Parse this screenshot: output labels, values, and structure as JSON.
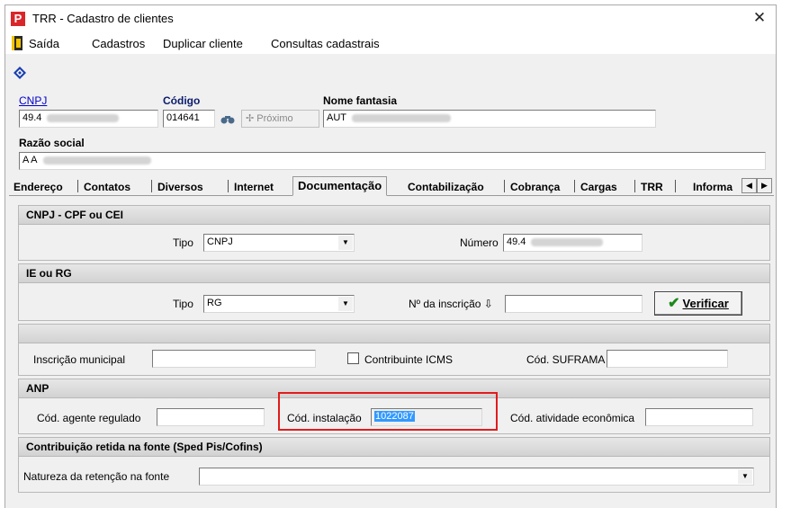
{
  "window": {
    "title": "TRR - Cadastro de clientes",
    "close_symbol": "✕",
    "app_icon": "P"
  },
  "menu": {
    "exit": "Saída",
    "registers": "Cadastros",
    "duplicate": "Duplicar cliente",
    "queries": "Consultas cadastrais"
  },
  "header": {
    "cnpj_label": "CNPJ",
    "cnpj_value": "49.4",
    "code_label": "Código",
    "code_value": "014641",
    "next_button": "✢ Próximo",
    "fantasy_label": "Nome fantasia",
    "fantasy_value": "AUT",
    "company_label": "Razão social",
    "company_value": "A A"
  },
  "tabs": [
    "Endereço",
    "Contatos",
    "Diversos",
    "Internet",
    "Documentação",
    "Contabilização",
    "Cobrança",
    "Cargas",
    "TRR",
    "Informa"
  ],
  "active_tab": "Documentação",
  "cnpj_section": {
    "title": "CNPJ - CPF ou CEI",
    "type_label": "Tipo",
    "type_value": "CNPJ",
    "number_label": "Número",
    "number_value": "49.4"
  },
  "ie_section": {
    "title": "IE ou RG",
    "type_label": "Tipo",
    "type_value": "RG",
    "inscription_label": "Nº da inscrição ⇩",
    "inscription_value": "",
    "verify_button": "Verificar"
  },
  "municipal_section": {
    "municipal_label": "Inscrição municipal",
    "icms_label": "Contribuinte ICMS",
    "icms_checked": false,
    "suframa_label": "Cód. SUFRAMA"
  },
  "anp_section": {
    "title": "ANP",
    "agent_label": "Cód. agente regulado",
    "installation_label": "Cód. instalação",
    "installation_value": "1022087",
    "activity_label": "Cód. atividade econômica"
  },
  "retention_section": {
    "title": "Contribuição retida na fonte  (Sped Pis/Cofins)",
    "nature_label": "Natureza da retenção na fonte",
    "nature_value": ""
  },
  "colors": {
    "accent_highlight": "#e11c1c",
    "selection": "#3399ff",
    "link": "#0000cc"
  }
}
